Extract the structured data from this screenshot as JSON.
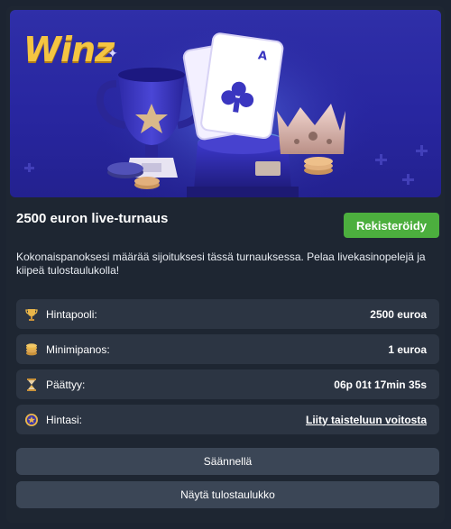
{
  "hero": {
    "brand": "Winz",
    "sparkle": "✦"
  },
  "tournament": {
    "title": "2500 euron live-turnaus",
    "register_label": "Rekisteröidy",
    "description": "Kokonaispanoksesi määrää sijoituksesi tässä turnauksessa. Pelaa livekasinopelejä ja kiipeä tulostaulukolla!"
  },
  "details": [
    {
      "icon": "trophy-icon",
      "label": "Hintapooli:",
      "value": "2500 euroa"
    },
    {
      "icon": "coins-icon",
      "label": "Minimipanos:",
      "value": "1 euroa"
    },
    {
      "icon": "hourglass-icon",
      "label": "Päättyy:",
      "value": "06p 01t 17min 35s"
    },
    {
      "icon": "star-medal-icon",
      "label": "Hintasi:",
      "value": "Liity taisteluun voitosta"
    }
  ],
  "buttons": {
    "rules_label": "Säännellä",
    "leaderboard_label": "Näytä tulostaulukko"
  },
  "colors": {
    "background": "#1c2431",
    "row": "#2c3543",
    "button": "#3b4656",
    "accent_green": "#4caf3e",
    "brand_gold": "#f4c542"
  }
}
